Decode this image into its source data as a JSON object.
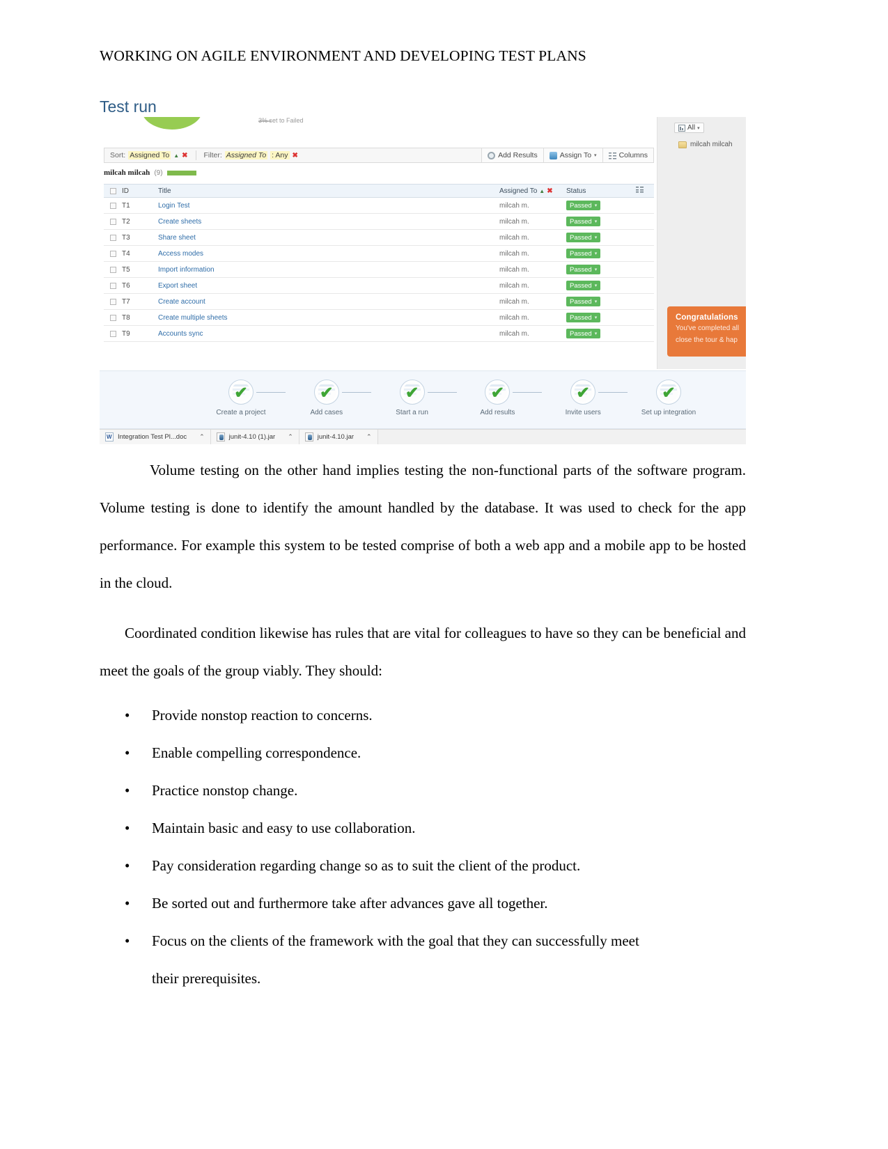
{
  "document": {
    "running_header": "WORKING ON AGILE ENVIRONMENT AND DEVELOPING TEST PLANS",
    "section_title": "Test run",
    "paragraphs": [
      "Volume testing on the other hand implies testing the non-functional parts of the software program. Volume testing is done to identify the amount handled by the database. It was used to check for the app performance. For example this system  to be tested comprise of both a web app and a mobile app to be hosted in the cloud.",
      "Coordinated condition likewise has rules that are vital for colleagues to have so they can be beneficial and meet the goals of the group viably. They should:"
    ],
    "bullet_marker": "•",
    "bullets": [
      "Provide nonstop reaction to concerns.",
      "Enable compelling correspondence.",
      "Practice nonstop change.",
      "Maintain basic and easy to use collaboration.",
      "Pay consideration regarding change so as to suit the client of the product.",
      "Be sorted out and furthermore take after advances gave all together.",
      "Focus on the clients of the framework with the goal that they can successfully meet"
    ],
    "bullet_last_continuation": "their prerequisites."
  },
  "screenshot": {
    "legend_sliver": "3% set to Failed",
    "toolbar": {
      "sort_label": "Sort:",
      "sort_value": "Assigned To",
      "sort_direction_icon": "sort-ascending-icon",
      "sort_clear_icon": "✖",
      "filter_label": "Filter:",
      "filter_field": "Assigned To",
      "filter_value": ": Any",
      "filter_clear_icon": "✖",
      "buttons": [
        {
          "label": "Add Results",
          "icon": "target-icon",
          "caret": ""
        },
        {
          "label": "Assign To",
          "icon": "person-icon",
          "caret": "▾"
        },
        {
          "label": "Columns",
          "icon": "columns-icon",
          "caret": ""
        }
      ]
    },
    "group": {
      "name": "milcah milcah",
      "count": "(9)"
    },
    "table": {
      "headers": {
        "id": "ID",
        "title": "Title",
        "assigned_to": "Assigned To",
        "assigned_sort_icon": "sort-ascending-icon",
        "assigned_clear_icon": "✖",
        "status": "Status",
        "columns_icon": "columns-icon"
      },
      "rows": [
        {
          "id": "T1",
          "title": "Login Test",
          "assigned_to": "milcah m.",
          "status": "Passed"
        },
        {
          "id": "T2",
          "title": "Create sheets",
          "assigned_to": "milcah m.",
          "status": "Passed"
        },
        {
          "id": "T3",
          "title": "Share sheet",
          "assigned_to": "milcah m.",
          "status": "Passed"
        },
        {
          "id": "T4",
          "title": "Access modes",
          "assigned_to": "milcah m.",
          "status": "Passed"
        },
        {
          "id": "T5",
          "title": "Import information",
          "assigned_to": "milcah m.",
          "status": "Passed"
        },
        {
          "id": "T6",
          "title": "Export sheet",
          "assigned_to": "milcah m.",
          "status": "Passed"
        },
        {
          "id": "T7",
          "title": "Create account",
          "assigned_to": "milcah m.",
          "status": "Passed"
        },
        {
          "id": "T8",
          "title": "Create multiple sheets",
          "assigned_to": "milcah m.",
          "status": "Passed"
        },
        {
          "id": "T9",
          "title": "Accounts sync",
          "assigned_to": "milcah m.",
          "status": "Passed"
        }
      ],
      "status_caret": "▾"
    },
    "sidebar": {
      "all_filter_label": "All",
      "all_filter_caret": "▾",
      "user_entry": "milcah milcah",
      "tour_tip": {
        "title": "Congratulations",
        "line1": "You've completed all",
        "line2": "close the tour & hap"
      }
    },
    "steps": [
      {
        "label": "Create a project",
        "check": "✔"
      },
      {
        "label": "Add cases",
        "check": "✔"
      },
      {
        "label": "Start a run",
        "check": "✔"
      },
      {
        "label": "Add results",
        "check": "✔"
      },
      {
        "label": "Invite users",
        "check": "✔"
      },
      {
        "label": "Set up integration",
        "check": "✔"
      }
    ],
    "downloads": [
      {
        "name": "Integration Test Pl...doc",
        "icon": "word-doc-icon",
        "chevron": "⌃"
      },
      {
        "name": "junit-4.10 (1).jar",
        "icon": "jar-file-icon",
        "chevron": "⌃"
      },
      {
        "name": "junit-4.10.jar",
        "icon": "jar-file-icon",
        "chevron": "⌃"
      }
    ]
  },
  "colors": {
    "accent_heading": "#2e5c86",
    "status_pass": "#5cb85c",
    "tour_tip": "#e8793a",
    "link": "#2f6da8"
  }
}
